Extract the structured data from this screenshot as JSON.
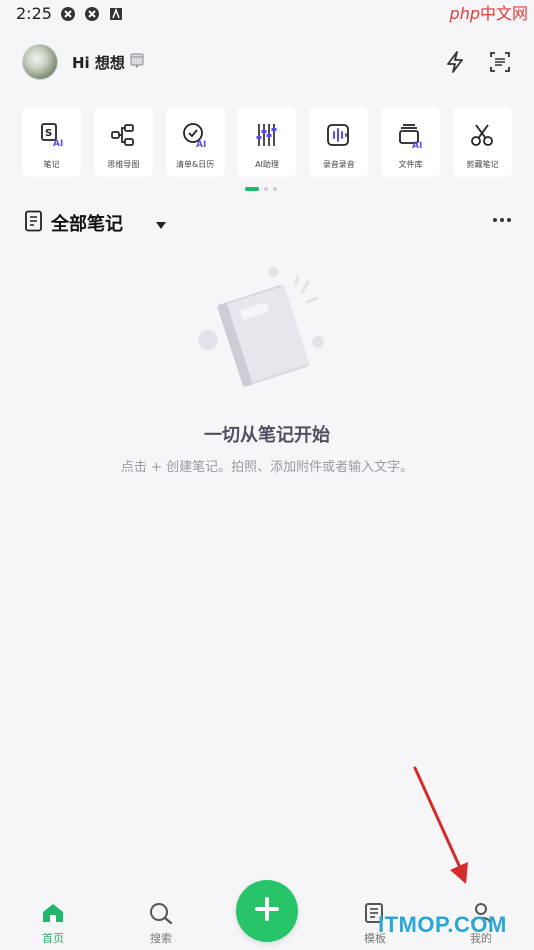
{
  "status_bar": {
    "time": "2:25"
  },
  "watermark_top": {
    "php": "php",
    "cn": "中文网"
  },
  "header": {
    "greeting": "Hi 想想"
  },
  "shortcuts": [
    {
      "label": "笔记",
      "icon": "ai-note-icon"
    },
    {
      "label": "思维导图",
      "icon": "mind-map-icon"
    },
    {
      "label": "清单&日历",
      "icon": "checklist-calendar-icon"
    },
    {
      "label": "AI助理",
      "icon": "ai-assistant-icon"
    },
    {
      "label": "录音录音",
      "icon": "voice-recording-icon"
    },
    {
      "label": "文件库",
      "icon": "file-library-icon"
    },
    {
      "label": "剪藏笔记",
      "icon": "clip-note-icon"
    }
  ],
  "section": {
    "title": "全部笔记"
  },
  "empty_state": {
    "title": "一切从笔记开始",
    "subtitle": "点击 + 创建笔记。拍照、添加附件或者输入文字。"
  },
  "bottom_nav": {
    "items": [
      {
        "label": "首页",
        "icon": "home-icon",
        "active": true
      },
      {
        "label": "搜索",
        "icon": "search-icon",
        "active": false
      },
      {
        "label": "模板",
        "icon": "template-icon",
        "active": false
      },
      {
        "label": "我的",
        "icon": "profile-icon",
        "active": false
      }
    ]
  },
  "watermark_bottom": {
    "text": "ITMOP.COM"
  },
  "colors": {
    "accent": "#27c46a",
    "ai_purple": "#5b4cf0",
    "arrow_red": "#d62b2b"
  }
}
